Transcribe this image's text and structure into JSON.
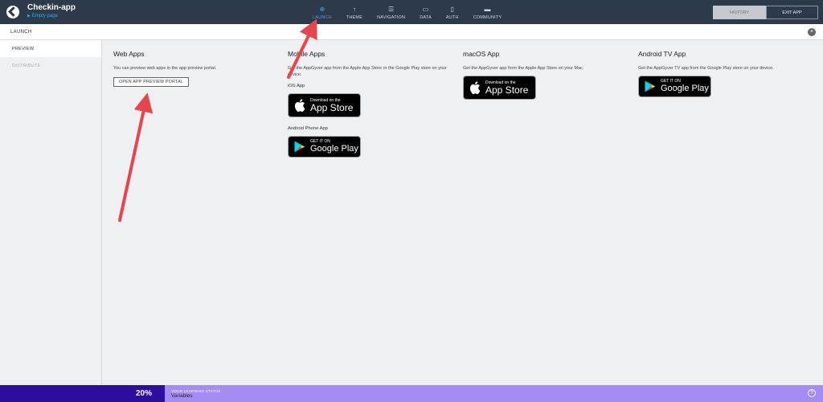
{
  "app": {
    "name": "Checkin-app",
    "page": "Empty page"
  },
  "nav": [
    {
      "icon": "⊕",
      "label": "LAUNCH",
      "active": true
    },
    {
      "icon": "↑",
      "label": "THEME"
    },
    {
      "icon": "☰",
      "label": "NAVIGATION"
    },
    {
      "icon": "▭",
      "label": "DATA"
    },
    {
      "icon": "▯",
      "label": "AUTH"
    },
    {
      "icon": "▬",
      "label": "COMMUNITY"
    }
  ],
  "actions": {
    "history": "HISTORY",
    "exit": "EXIT APP"
  },
  "subbar": {
    "title": "LAUNCH",
    "close_icon": "×"
  },
  "sidebar": {
    "items": [
      {
        "label": "PREVIEW",
        "active": true
      },
      {
        "label": "DISTRIBUTE"
      }
    ]
  },
  "web": {
    "title": "Web Apps",
    "desc": "You can preview web apps in the app preview portal.",
    "button": "OPEN APP PREVIEW PORTAL"
  },
  "mobile": {
    "title": "Mobile Apps",
    "desc": "Get the AppGyver app from the Apple App Store or the Google Play store on your device.",
    "ios_label": "iOS App",
    "android_label": "Android Phone App"
  },
  "macos": {
    "title": "macOS App",
    "desc": "Get the AppGyver app from the Apple App Store on your Mac."
  },
  "androidtv": {
    "title": "Android TV App",
    "desc": "Get the AppGyver TV app from the Google Play store on your device."
  },
  "badges": {
    "appstore_small": "Download on the",
    "appstore_big": "App Store",
    "googleplay_small": "GET IT ON",
    "googleplay_big": "Google Play"
  },
  "status": {
    "percent": "20%",
    "label": "YOUR LEARNING STATUS",
    "value": "Variables",
    "help": "?"
  },
  "colors": {
    "accent": "#32a6ff",
    "annotation": "#e8454b",
    "status_dark": "#2c0da0",
    "status_light": "#a48cf4"
  }
}
